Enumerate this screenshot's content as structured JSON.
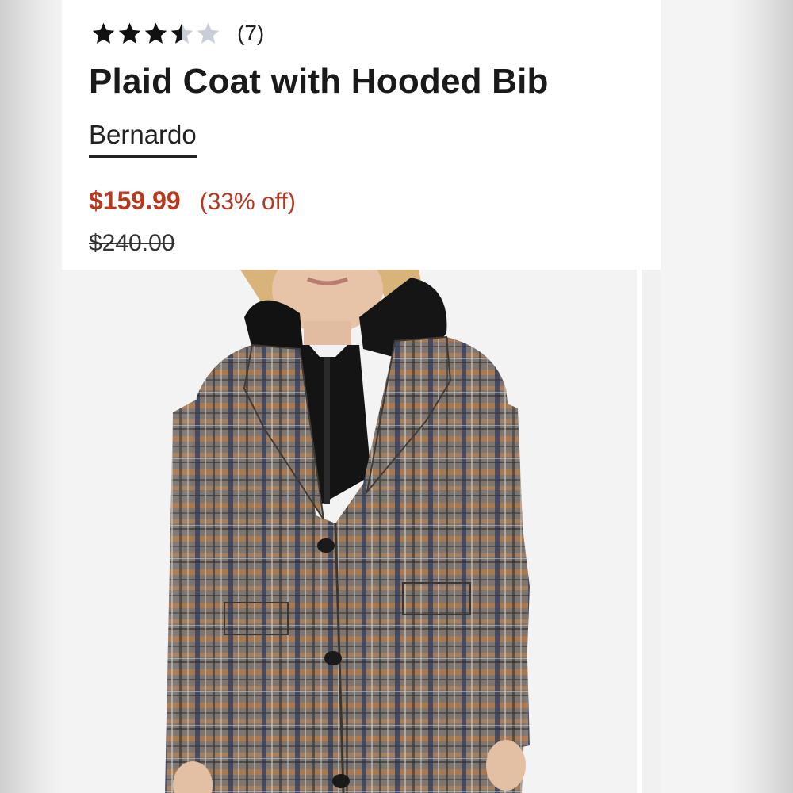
{
  "product": {
    "rating": {
      "value": 3.5,
      "max": 5,
      "review_count": "(7)"
    },
    "title": "Plaid Coat with Hooded Bib",
    "brand": "Bernardo",
    "price": {
      "sale": "$159.99",
      "discount": "(33% off)",
      "original": "$240.00"
    },
    "image": {
      "icon": "product-photo-plaid-coat"
    }
  },
  "colors": {
    "sale_red": "#b8381e",
    "star_filled": "#111111",
    "star_empty": "#c9ced6",
    "text": "#1a1a1a"
  }
}
